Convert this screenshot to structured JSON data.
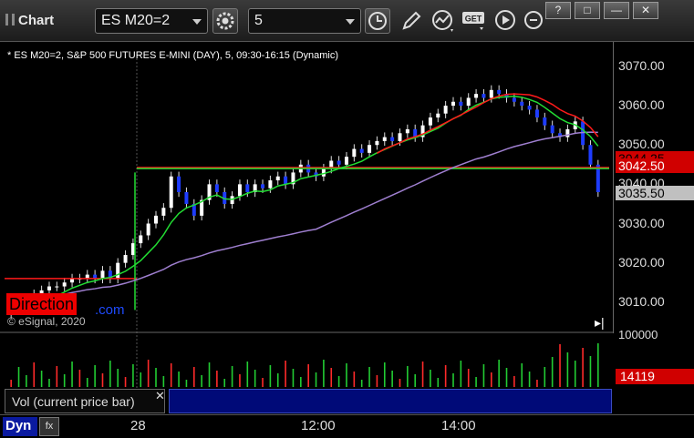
{
  "app": {
    "title": "Chart"
  },
  "toolbar": {
    "symbol": "ES M20=2",
    "interval": "5",
    "get_label": "GET"
  },
  "window_buttons": [
    "?",
    "□",
    "—",
    "✕"
  ],
  "chart": {
    "header": "* ES M20=2, S&P 500 FUTURES E-MINI (DAY), 5, 09:30-16:15 (Dynamic)",
    "copyright": "© eSignal, 2020",
    "logo_text": "Direction",
    "logo_suffix": ".com",
    "price_tags": [
      {
        "text": "3044.25",
        "bg": "#d00000",
        "fg": "#000000"
      },
      {
        "text": "3042.50",
        "bg": "#d00000",
        "fg": "#ffffff"
      },
      {
        "text": "3035.50",
        "bg": "#c0c0c0",
        "fg": "#000000"
      }
    ],
    "jump_icon": "▸|"
  },
  "chart_data": {
    "type": "candlestick",
    "y_ticks": [
      3010.0,
      3020.0,
      3030.0,
      3040.0,
      3050.0,
      3060.0,
      3070.0
    ],
    "y_labels": [
      "3010.00",
      "3020.00",
      "3030.00",
      "3040.00",
      "3050.00",
      "3060.00",
      "3070.00"
    ],
    "ylim": [
      3003,
      3073
    ],
    "x_labels": [
      "28",
      "12:00",
      "14:00"
    ],
    "bar_count": 78,
    "closes": [
      3008,
      3009,
      3011,
      3012,
      3013,
      3014,
      3014,
      3015,
      3016,
      3016,
      3017,
      3016,
      3018,
      3016,
      3020,
      3022,
      3025,
      3027,
      3030,
      3032,
      3034,
      3042,
      3038,
      3035,
      3032,
      3036,
      3040,
      3038,
      3035,
      3037,
      3040,
      3038,
      3040,
      3039,
      3041,
      3042,
      3040,
      3043,
      3045,
      3043,
      3042,
      3044,
      3046,
      3045,
      3047,
      3049,
      3048,
      3050,
      3051,
      3052,
      3051,
      3053,
      3054,
      3052,
      3055,
      3057,
      3058,
      3060,
      3061,
      3060,
      3062,
      3063,
      3062,
      3064,
      3063,
      3062,
      3061,
      3060,
      3059,
      3057,
      3055,
      3053,
      3052,
      3054,
      3056,
      3050,
      3045,
      3038
    ],
    "series": [
      {
        "name": "",
        "color": "#ff1a1a"
      },
      {
        "name": "",
        "color": "#22dd33"
      },
      {
        "name": "",
        "color": "#22dd33"
      },
      {
        "name": "",
        "color": "#9f7fd0"
      }
    ],
    "grid": false,
    "volume": {
      "max_label": "100000",
      "last": "14119",
      "panel_label": "Vol (current price bar)"
    }
  },
  "bottom": {
    "dyn": "Dyn",
    "fx": "fx"
  }
}
